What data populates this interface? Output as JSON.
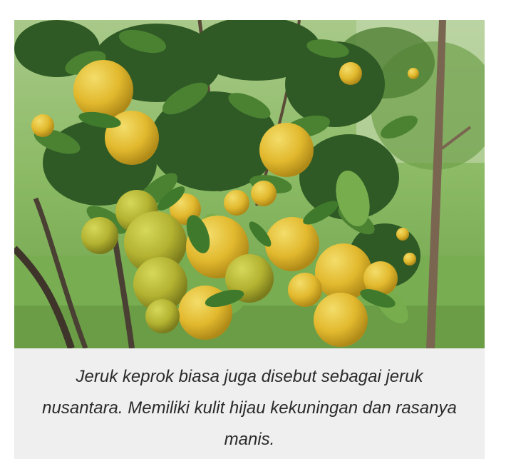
{
  "photo": {
    "subject": "citrus-tree-with-fruit",
    "colors": {
      "fruit_yellow": "#e6c23a",
      "fruit_green": "#b9b834",
      "leaf_dark": "#2f5a25",
      "leaf_light": "#5f9a3c",
      "grass": "#7fb05a",
      "trunk": "#6a5a48"
    }
  },
  "caption": {
    "text": "Jeruk keprok biasa juga disebut sebagai jeruk nusantara. Memiliki kulit hijau kekuningan dan rasanya manis."
  }
}
